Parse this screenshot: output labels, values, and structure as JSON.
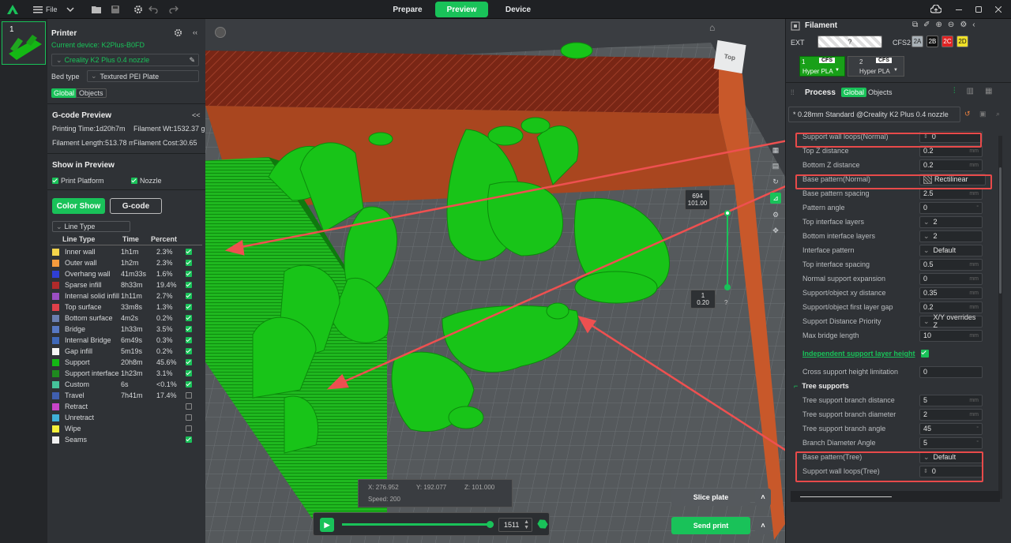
{
  "topbar": {
    "file_label": "File",
    "tabs": [
      "Prepare",
      "Preview",
      "Device"
    ]
  },
  "printer": {
    "title": "Printer",
    "current_device": "Current device: K2Plus-B0FD",
    "preset": "Creality K2 Plus 0.4 nozzle",
    "bed_type_label": "Bed type",
    "bed_type_value": "Textured PEI Plate",
    "tab_global": "Global",
    "tab_objects": "Objects"
  },
  "gcode": {
    "title": "G-code Preview",
    "printing_time": "Printing Time:1d20h7m",
    "filament_wt": "Filament Wt:1532.37 g",
    "filament_length": "Filament Length:513.78 m",
    "filament_cost": "Filament Cost:30.65"
  },
  "show": {
    "title": "Show in Preview",
    "print_platform": "Print Platform",
    "nozzle": "Nozzle",
    "color_show": "Color Show",
    "gcode_btn": "G-code",
    "line_type_select": "Line Type",
    "col_type": "Line Type",
    "col_time": "Time",
    "col_percent": "Percent"
  },
  "line_types": [
    {
      "name": "Inner wall",
      "time": "1h1m",
      "pct": "2.3%",
      "color": "#f5d44a",
      "on": true
    },
    {
      "name": "Outer wall",
      "time": "1h2m",
      "pct": "2.3%",
      "color": "#f59b3d",
      "on": true
    },
    {
      "name": "Overhang wall",
      "time": "41m33s",
      "pct": "1.6%",
      "color": "#2f3fd6",
      "on": true
    },
    {
      "name": "Sparse infill",
      "time": "8h33m",
      "pct": "19.4%",
      "color": "#b02a2a",
      "on": true
    },
    {
      "name": "Internal solid infill",
      "time": "1h11m",
      "pct": "2.7%",
      "color": "#9b4fc4",
      "on": true
    },
    {
      "name": "Top surface",
      "time": "33m8s",
      "pct": "1.3%",
      "color": "#e0404a",
      "on": true
    },
    {
      "name": "Bottom surface",
      "time": "4m2s",
      "pct": "0.2%",
      "color": "#6b7fb0",
      "on": true
    },
    {
      "name": "Bridge",
      "time": "1h33m",
      "pct": "3.5%",
      "color": "#5778c2",
      "on": true
    },
    {
      "name": "Internal Bridge",
      "time": "6m49s",
      "pct": "0.3%",
      "color": "#3f68b8",
      "on": true
    },
    {
      "name": "Gap infill",
      "time": "5m19s",
      "pct": "0.2%",
      "color": "#f5f5f5",
      "on": true
    },
    {
      "name": "Support",
      "time": "20h8m",
      "pct": "45.6%",
      "color": "#14b814",
      "on": true
    },
    {
      "name": "Support interface",
      "time": "1h23m",
      "pct": "3.1%",
      "color": "#1f8a1f",
      "on": true
    },
    {
      "name": "Custom",
      "time": "6s",
      "pct": "<0.1%",
      "color": "#45c29a",
      "on": true
    },
    {
      "name": "Travel",
      "time": "7h41m",
      "pct": "17.4%",
      "color": "#3f5fb0",
      "on": false
    },
    {
      "name": "Retract",
      "time": "",
      "pct": "",
      "color": "#c844c8",
      "on": false
    },
    {
      "name": "Unretract",
      "time": "",
      "pct": "",
      "color": "#3fb0d8",
      "on": false
    },
    {
      "name": "Wipe",
      "time": "",
      "pct": "",
      "color": "#f5f03a",
      "on": false
    },
    {
      "name": "Seams",
      "time": "",
      "pct": "",
      "color": "#f0f0f0",
      "on": true
    }
  ],
  "viewport": {
    "nav_cube": "Top",
    "layer_top_a": "694",
    "layer_top_b": "101.00",
    "layer_bot_a": "1",
    "layer_bot_b": "0.20",
    "qmark": "?",
    "coord_x": "X: 276.952",
    "coord_y": "Y: 192.077",
    "coord_z": "Z: 101.000",
    "speed": "Speed: 200",
    "move_value": "1511",
    "move_fill": 0.98,
    "layer_range": [
      0.0,
      1.0
    ],
    "slice_plate": "Slice plate",
    "send_print": "Send print"
  },
  "filament": {
    "title": "Filament",
    "ext": "EXT",
    "ext_q": "?",
    "cfs2": "CFS2",
    "slots": [
      "2A",
      "2B",
      "2C",
      "2D"
    ],
    "slot_colors": [
      "#a9b1b7",
      "#111111",
      "#e02424",
      "#f0e128"
    ],
    "s1_num": "1",
    "s1_badge": "CFS",
    "s1_name": "Hyper PLA",
    "s2_num": "2",
    "s2_badge": "CFS",
    "s2_name": "Hyper PLA"
  },
  "process": {
    "title": "Process",
    "tab_global": "Global",
    "tab_objects": "Objects",
    "preset": "* 0.28mm Standard @Creality K2 Plus 0.4 nozzle",
    "tree_supports": "Tree supports"
  },
  "params": [
    {
      "label": "Support wall loops(Normal)",
      "value": "0",
      "kind": "spin"
    },
    {
      "label": "Top Z distance",
      "value": "0.2",
      "unit": "mm"
    },
    {
      "label": "Bottom Z distance",
      "value": "0.2",
      "unit": "mm"
    },
    {
      "label": "Base pattern(Normal)",
      "value": "Rectilinear",
      "kind": "pattern"
    },
    {
      "label": "Base pattern spacing",
      "value": "2.5",
      "unit": "mm"
    },
    {
      "label": "Pattern angle",
      "value": "0",
      "unit": "°"
    },
    {
      "label": "Top interface layers",
      "value": "2",
      "kind": "select"
    },
    {
      "label": "Bottom interface layers",
      "value": "2",
      "kind": "select"
    },
    {
      "label": "Interface pattern",
      "value": "Default",
      "kind": "select"
    },
    {
      "label": "Top interface spacing",
      "value": "0.5",
      "unit": "mm"
    },
    {
      "label": "Normal support expansion",
      "value": "0",
      "unit": "mm"
    },
    {
      "label": "Support/object xy distance",
      "value": "0.35",
      "unit": "mm"
    },
    {
      "label": "Support/object first layer gap",
      "value": "0.2",
      "unit": "mm"
    },
    {
      "label": "Support Distance Priority",
      "value": "X/Y overrides Z",
      "kind": "select"
    },
    {
      "label": "Max bridge length",
      "value": "10",
      "unit": "mm"
    },
    {
      "label": "Independent support layer height",
      "value": "",
      "kind": "check"
    },
    {
      "label": "Cross support height limitation",
      "value": "0"
    },
    {
      "label": "Tree supports",
      "kind": "section"
    },
    {
      "label": "Tree support branch distance",
      "value": "5",
      "unit": "mm"
    },
    {
      "label": "Tree support branch diameter",
      "value": "2",
      "unit": "mm"
    },
    {
      "label": "Tree support branch angle",
      "value": "45",
      "unit": "°"
    },
    {
      "label": "Branch Diameter Angle",
      "value": "5",
      "unit": "°"
    },
    {
      "label": "Base pattern(Tree)",
      "value": "Default",
      "kind": "select"
    },
    {
      "label": "Support wall loops(Tree)",
      "value": "0",
      "kind": "spin"
    }
  ]
}
